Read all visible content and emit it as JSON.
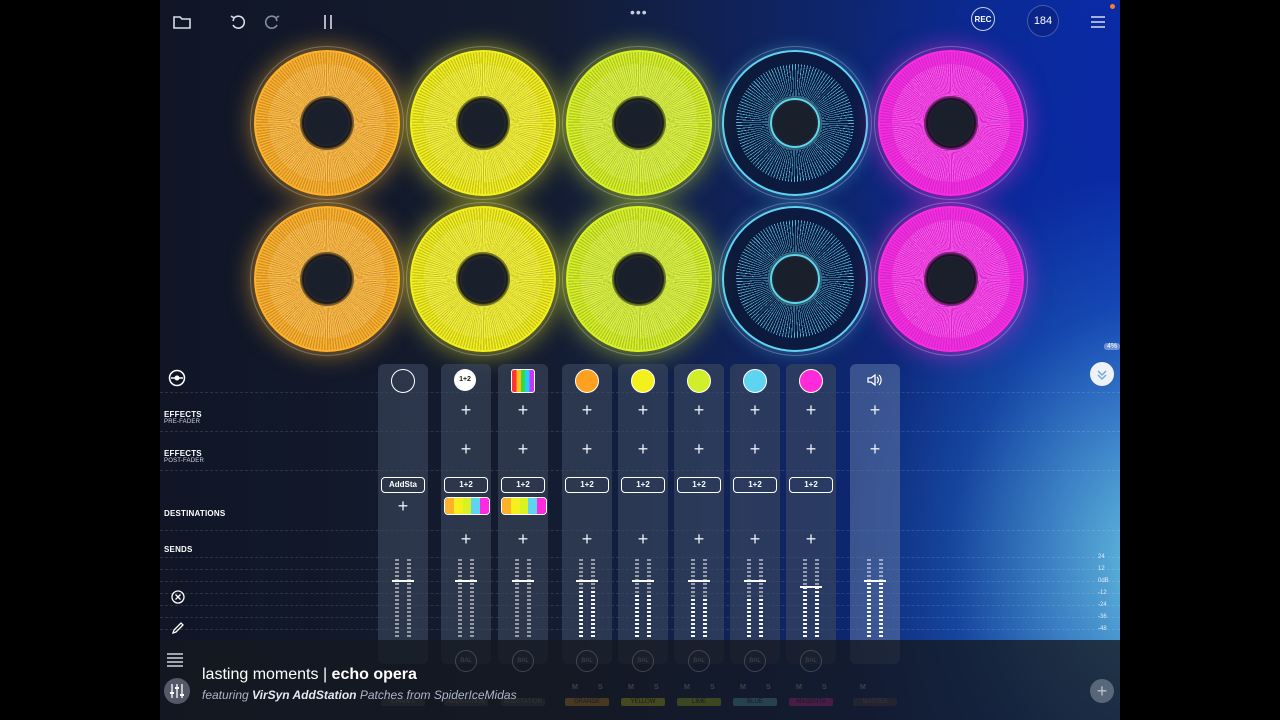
{
  "toolbar": {
    "rec_label": "REC",
    "bpm": "184",
    "more_dots": "•••"
  },
  "loops": {
    "colors": [
      "#ffb12a",
      "#f4f01c",
      "#d8f224",
      "#5fd4f0",
      "#ff2ae0"
    ],
    "top_row": [
      {
        "color_name": "orange",
        "color": "#ffb12a"
      },
      {
        "color_name": "yellow",
        "color": "#f4f01c"
      },
      {
        "color_name": "lime",
        "color": "#d8f224"
      },
      {
        "color_name": "blue",
        "color": "#5fd4f0"
      },
      {
        "color_name": "magenta",
        "color": "#ff2ae0"
      }
    ],
    "bottom_row": [
      {
        "color_name": "orange",
        "color": "#ffb12a"
      },
      {
        "color_name": "yellow",
        "color": "#f4f01c"
      },
      {
        "color_name": "lime",
        "color": "#d8f224"
      },
      {
        "color_name": "blue",
        "color": "#5fd4f0"
      },
      {
        "color_name": "magenta",
        "color": "#ff2ae0"
      }
    ]
  },
  "mixer": {
    "labels": {
      "effects_pre": "EFFECTS",
      "effects_pre_sub": "PRE-FADER",
      "effects_post": "EFFECTS",
      "effects_post_sub": "POST-FADER",
      "destinations": "DESTINATIONS",
      "sends": "SENDS"
    },
    "percent_badge": "4%",
    "db_scale": [
      "24",
      "12",
      "0dB",
      "-12",
      "-24",
      "-36",
      "-48"
    ],
    "strips": [
      {
        "name": "CHAIN 1",
        "head": "dial-icon",
        "pill": "AddSta",
        "bar_color": "#444"
      },
      {
        "name": "ADDSTATION",
        "head": "1+2",
        "pill": "1+2",
        "bar_color": "#444"
      },
      {
        "name": "ADDSTATION",
        "head": "addstation-icon",
        "pill": "1+2",
        "bar_color": "#444"
      },
      {
        "name": "ORANGE",
        "head": "#ffa020",
        "pill": "1+2",
        "bar_color": "#ffb12a"
      },
      {
        "name": "YELLOW",
        "head": "#f4f01c",
        "pill": "1+2",
        "bar_color": "#f4f01c"
      },
      {
        "name": "LIME",
        "head": "#d0ee2a",
        "pill": "1+2",
        "bar_color": "#c8ee2a"
      },
      {
        "name": "BLUE",
        "head": "#5fd4f0",
        "pill": "1+2",
        "bar_color": "#5fd4f0"
      },
      {
        "name": "MAGENTA",
        "head": "#ff2ad8",
        "pill": "1+2",
        "bar_color": "#ff2ad8"
      },
      {
        "name": "MASTER",
        "head": "speaker-icon",
        "pill": "",
        "bar_color": "#556"
      }
    ],
    "bal_label": "BAL",
    "mute_label": "M",
    "solo_label": "S"
  },
  "caption": {
    "song_title": "lasting moments",
    "separator": " | ",
    "artist": "echo opera",
    "featuring_prefix": "featuring ",
    "featuring_product": "VirSyn AddStation",
    "featuring_suffix": " Patches from SpiderIceMidas"
  }
}
